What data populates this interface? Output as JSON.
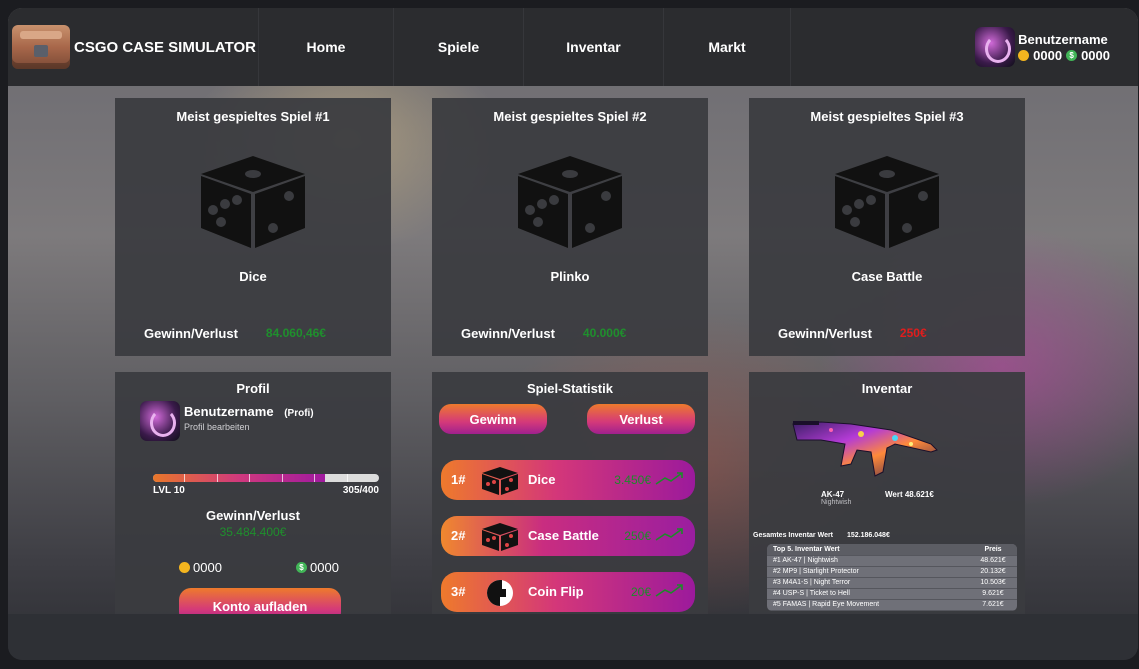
{
  "nav": {
    "brand": "CSGO CASE SIMULATOR",
    "items": [
      "Home",
      "Spiele",
      "Inventar",
      "Markt"
    ],
    "user": {
      "name": "Benutzername",
      "coins": "0000",
      "dollars": "0000"
    }
  },
  "top_games": [
    {
      "title": "Meist gespieltes Spiel #1",
      "game": "Dice",
      "wl_label": "Gewinn/Verlust",
      "wl_value": "84.060,46€",
      "wl_color": "#1f8f2d"
    },
    {
      "title": "Meist gespieltes Spiel #2",
      "game": "Plinko",
      "wl_label": "Gewinn/Verlust",
      "wl_value": "40.000€",
      "wl_color": "#1f8f2d"
    },
    {
      "title": "Meist gespieltes Spiel #3",
      "game": "Case Battle",
      "wl_label": "Gewinn/Verlust",
      "wl_value": "250€",
      "wl_color": "#e01d1d"
    }
  ],
  "profile": {
    "title": "Profil",
    "name": "Benutzername",
    "tag": "(Profi)",
    "edit": "Profil bearbeiten",
    "level": "LVL 10",
    "xp": "305/400",
    "xp_fraction": 0.76,
    "wl_label": "Gewinn/Verlust",
    "wl_value": "35.484.400€",
    "coins": "0000",
    "dollars": "0000",
    "topup": "Konto aufladen"
  },
  "stats": {
    "title": "Spiel-Statistik",
    "win": "Gewinn",
    "loss": "Verlust",
    "rows": [
      {
        "rank": "1#",
        "name": "Dice",
        "amount": "3.450€",
        "icon": "dice-icon"
      },
      {
        "rank": "2#",
        "name": "Case Battle",
        "amount": "250€",
        "icon": "dice-icon"
      },
      {
        "rank": "3#",
        "name": "Coin Flip",
        "amount": "20€",
        "icon": "coin-flip-icon"
      }
    ]
  },
  "inventory": {
    "title": "Inventar",
    "weapon": "AK-47",
    "skin": "Nightwish",
    "value": "Wert  48.621€",
    "total_label": "Gesamtes Inventar Wert",
    "total_value": "152.186.048€",
    "table_head": "Top 5. Inventar Wert",
    "price_head": "Preis",
    "items": [
      {
        "label": "#1 AK-47 | Nightwish",
        "price": "48.621€"
      },
      {
        "label": "#2 MP9 | Starlight Protector",
        "price": "20.132€"
      },
      {
        "label": "#3 M4A1-S | Night Terror",
        "price": "10.503€"
      },
      {
        "label": "#4 USP-S | Ticket to Hell",
        "price": "9.621€"
      },
      {
        "label": "#5 FAMAS | Rapid Eye Movement",
        "price": "7.621€"
      }
    ]
  }
}
